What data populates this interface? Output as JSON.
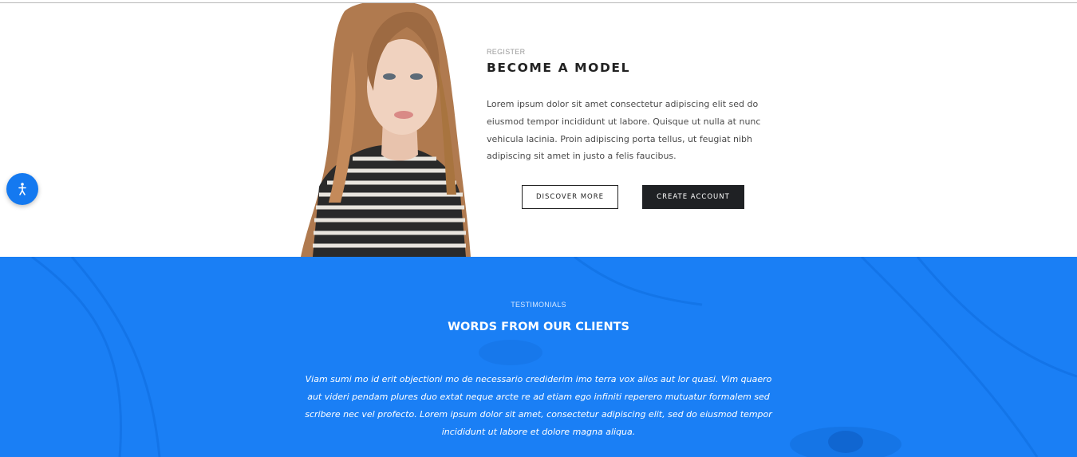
{
  "register": {
    "eyebrow": "REGISTER",
    "title": "BECOME A MODEL",
    "description": "Lorem ipsum dolor sit amet consectetur adipiscing elit sed do eiusmod tempor incididunt ut labore. Quisque ut nulla at nunc vehicula lacinia. Proin adipiscing porta tellus, ut feugiat nibh adipiscing sit amet in justo a felis faucibus.",
    "discover_label": "DISCOVER MORE",
    "create_label": "CREATE ACCOUNT"
  },
  "floating_button": {
    "icon": "accessibility-icon"
  },
  "testimonials": {
    "eyebrow": "TESTIMONIALS",
    "title": "WORDS FROM OUR CLIENTS",
    "quote": "Viam sumi mo id erit objectioni mo de necessario crediderim imo terra vox alios aut lor quasi. Vim quaero aut videri pendam plures duo extat neque arcte re ad etiam ego infiniti reperero mutuatur formalem sed scribere nec vel profecto. Lorem ipsum dolor sit amet, consectetur adipiscing elit, sed do eiusmod tempor incididunt ut labore et dolore magna aliqua."
  },
  "colors": {
    "accent_blue": "#1a7ff5",
    "dark_button": "#1f2124",
    "text_dark": "#222222"
  }
}
